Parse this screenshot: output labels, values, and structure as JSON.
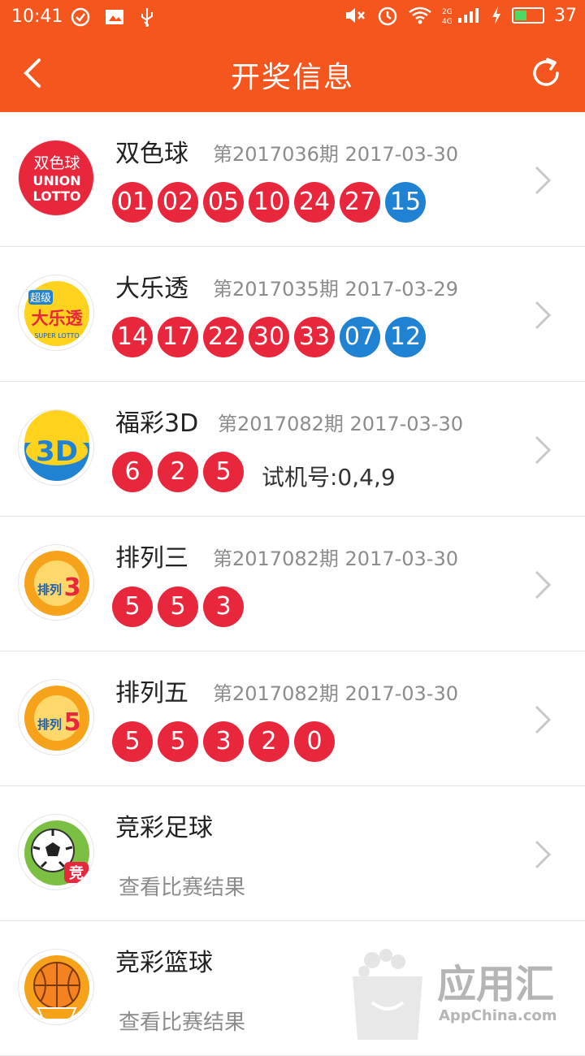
{
  "status_bar": {
    "time": "10:41",
    "battery": "37"
  },
  "header": {
    "title": "开奖信息"
  },
  "rows": [
    {
      "name": "双色球",
      "issue": "第2017036期",
      "date": "2017-03-30",
      "balls": [
        {
          "n": "01",
          "c": "red"
        },
        {
          "n": "02",
          "c": "red"
        },
        {
          "n": "05",
          "c": "red"
        },
        {
          "n": "10",
          "c": "red"
        },
        {
          "n": "24",
          "c": "red"
        },
        {
          "n": "27",
          "c": "red"
        },
        {
          "n": "15",
          "c": "blue"
        }
      ]
    },
    {
      "name": "大乐透",
      "issue": "第2017035期",
      "date": "2017-03-29",
      "balls": [
        {
          "n": "14",
          "c": "red"
        },
        {
          "n": "17",
          "c": "red"
        },
        {
          "n": "22",
          "c": "red"
        },
        {
          "n": "30",
          "c": "red"
        },
        {
          "n": "33",
          "c": "red"
        },
        {
          "n": "07",
          "c": "blue"
        },
        {
          "n": "12",
          "c": "blue"
        }
      ]
    },
    {
      "name": "福彩3D",
      "issue": "第2017082期",
      "date": "2017-03-30",
      "balls": [
        {
          "n": "6",
          "c": "red"
        },
        {
          "n": "2",
          "c": "red"
        },
        {
          "n": "5",
          "c": "red"
        }
      ],
      "trial": "试机号:0,4,9"
    },
    {
      "name": "排列三",
      "issue": "第2017082期",
      "date": "2017-03-30",
      "balls": [
        {
          "n": "5",
          "c": "red"
        },
        {
          "n": "5",
          "c": "red"
        },
        {
          "n": "3",
          "c": "red"
        }
      ]
    },
    {
      "name": "排列五",
      "issue": "第2017082期",
      "date": "2017-03-30",
      "balls": [
        {
          "n": "5",
          "c": "red"
        },
        {
          "n": "5",
          "c": "red"
        },
        {
          "n": "3",
          "c": "red"
        },
        {
          "n": "2",
          "c": "red"
        },
        {
          "n": "0",
          "c": "red"
        }
      ]
    },
    {
      "name": "竞彩足球",
      "subtitle": "查看比赛结果"
    },
    {
      "name": "竞彩篮球",
      "subtitle": "查看比赛结果"
    }
  ],
  "logos": {
    "ssq": {
      "line1": "双色球",
      "line2": "UNION",
      "line3": "LOTTO"
    },
    "dlt": {
      "top": "超级",
      "main": "大乐透",
      "bottom": "SUPER LOTTO"
    },
    "fc3d": {
      "text": "3D"
    },
    "pl3": {
      "text": "排列",
      "num": "3"
    },
    "pl5": {
      "text": "排列",
      "num": "5"
    },
    "jczq": {
      "badge": "竞"
    }
  },
  "watermark": {
    "brand": "应用汇",
    "site": "AppChina.com"
  }
}
